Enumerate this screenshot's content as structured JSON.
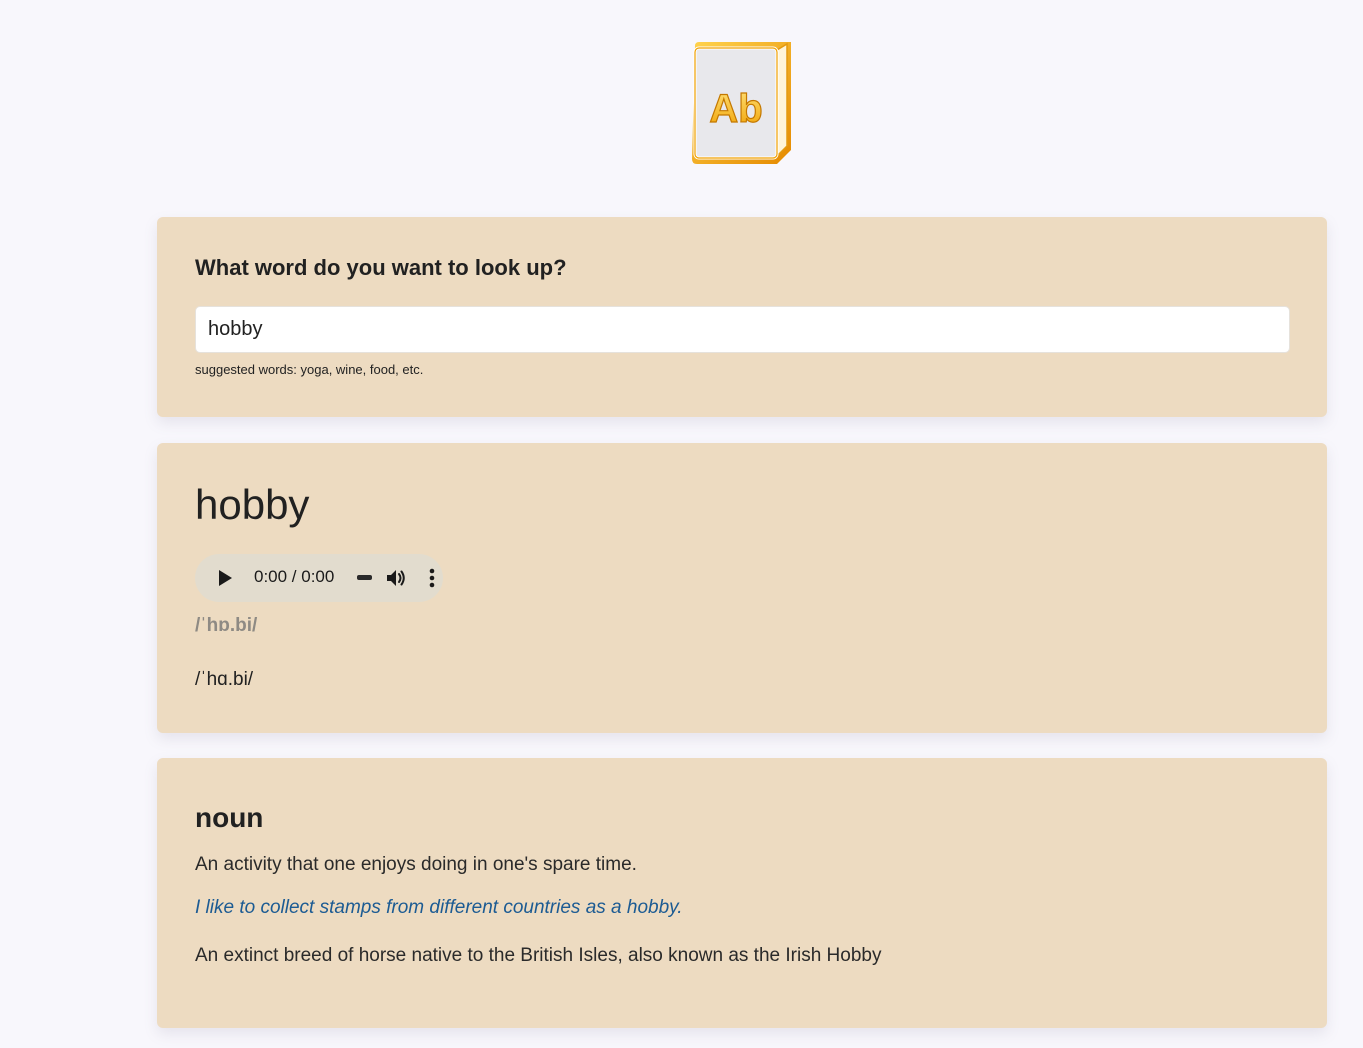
{
  "logo": {
    "text": "Ab",
    "icon": "dictionary-book-icon"
  },
  "search": {
    "heading": "What word do you want to look up?",
    "value": "hobby",
    "hint": "suggested words: yoga, wine, food, etc."
  },
  "word": {
    "title": "hobby",
    "audio": {
      "time": "0:00 / 0:00"
    },
    "phonetics": [
      "/ˈhɒ.bi/",
      "/ˈhɑ.bi/"
    ]
  },
  "meanings": [
    {
      "part_of_speech": "noun",
      "definitions": [
        {
          "text": "An activity that one enjoys doing in one's spare time.",
          "example": "I like to collect stamps from different countries as a hobby."
        },
        {
          "text": "An extinct breed of horse native to the British Isles, also known as the Irish Hobby"
        }
      ]
    }
  ],
  "colors": {
    "background": "#f8f7fc",
    "card": "#eddbc1",
    "example_text": "#1c5b93",
    "logo_gold": "#f3a712"
  }
}
